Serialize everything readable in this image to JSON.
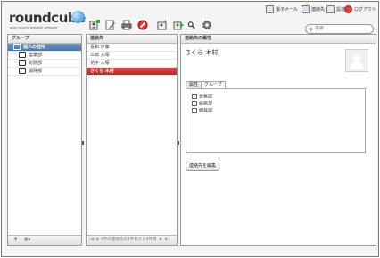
{
  "app": {
    "logo_text": "roundcube",
    "tagline": "open source webmail software",
    "accent_color": "#3d6ea5",
    "selection_color": "#c83434"
  },
  "topnav": {
    "mail": "電子メール",
    "contacts": "連絡先",
    "settings": "設定",
    "logout": "ログアウト"
  },
  "toolbar": {
    "icons": [
      "add-contact-icon",
      "edit-icon",
      "print-icon",
      "delete-icon",
      "import-icon",
      "export-icon",
      "search-icon",
      "gear-icon"
    ]
  },
  "search": {
    "placeholder": "検索..."
  },
  "groups": {
    "header": "グループ",
    "items": [
      {
        "label": "個人の住所",
        "selected": true
      },
      {
        "label": "営業部",
        "selected": false
      },
      {
        "label": "総務部",
        "selected": false
      },
      {
        "label": "開発部",
        "selected": false
      }
    ],
    "footer_add": "+",
    "footer_gear": "⚙▾"
  },
  "contacts": {
    "header": "連絡先",
    "items": [
      {
        "name": "喜和 伊藤",
        "selected": false
      },
      {
        "name": "三郎 大塚",
        "selected": false
      },
      {
        "name": "花子 大塚",
        "selected": false
      },
      {
        "name": "さくら 木村",
        "selected": true
      }
    ],
    "footer_status": "4件の連絡先の1件目から4件目"
  },
  "details": {
    "header": "連絡先の属性",
    "name": "さくら 木村",
    "tabs": [
      {
        "label": "属性",
        "active": false
      },
      {
        "label": "グループ",
        "active": true
      }
    ],
    "group_checks": [
      {
        "label": "営業部",
        "checked": true
      },
      {
        "label": "総務部",
        "checked": false
      },
      {
        "label": "開発部",
        "checked": false
      }
    ],
    "edit_button": "連絡先を編集"
  }
}
